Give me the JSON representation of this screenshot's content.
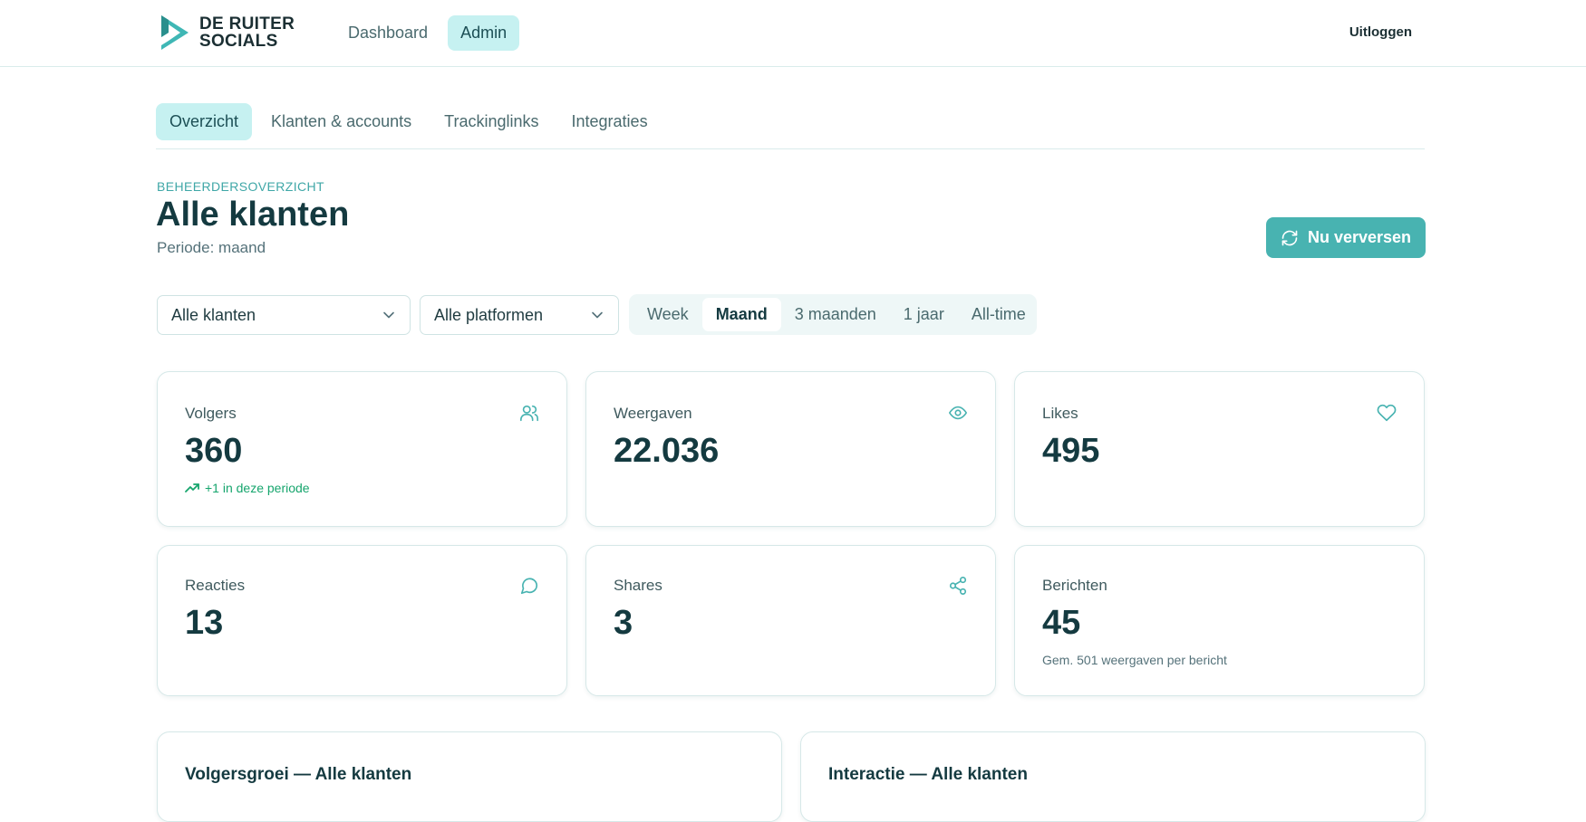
{
  "brand": {
    "line1": "DE RUITER",
    "line2": "SOCIALS",
    "color": "#3fb7b5"
  },
  "topnav": {
    "items": [
      {
        "label": "Dashboard",
        "active": false
      },
      {
        "label": "Admin",
        "active": true
      }
    ],
    "logout_label": "Uitloggen"
  },
  "subtabs": [
    {
      "label": "Overzicht",
      "active": true
    },
    {
      "label": "Klanten & accounts",
      "active": false
    },
    {
      "label": "Trackinglinks",
      "active": false
    },
    {
      "label": "Integraties",
      "active": false
    }
  ],
  "header": {
    "eyebrow": "BEHEERDERSOVERZICHT",
    "title": "Alle klanten",
    "period": "Periode: maand",
    "refresh_label": "Nu verversen"
  },
  "filters": {
    "client_select": "Alle klanten",
    "platform_select": "Alle platformen",
    "periods": [
      {
        "label": "Week",
        "active": false
      },
      {
        "label": "Maand",
        "active": true
      },
      {
        "label": "3 maanden",
        "active": false
      },
      {
        "label": "1 jaar",
        "active": false
      },
      {
        "label": "All-time",
        "active": false
      }
    ]
  },
  "stats": {
    "followers": {
      "label": "Volgers",
      "value": "360",
      "sub": "+1 in deze periode",
      "icon": "users-icon"
    },
    "views": {
      "label": "Weergaven",
      "value": "22.036",
      "icon": "eye-icon"
    },
    "likes": {
      "label": "Likes",
      "value": "495",
      "icon": "heart-icon"
    },
    "comments": {
      "label": "Reacties",
      "value": "13",
      "icon": "message-circle-icon"
    },
    "shares": {
      "label": "Shares",
      "value": "3",
      "icon": "share-icon"
    },
    "posts": {
      "label": "Berichten",
      "value": "45",
      "sub": "Gem. 501 weergaven per bericht"
    }
  },
  "panels": {
    "left_title": "Volgersgroei — Alle klanten",
    "right_title": "Interactie — Alle klanten"
  },
  "colors": {
    "accent": "#48b3b1",
    "accent_light": "#c6f1f1",
    "positive": "#16a56d",
    "text_dark": "#143a40"
  }
}
